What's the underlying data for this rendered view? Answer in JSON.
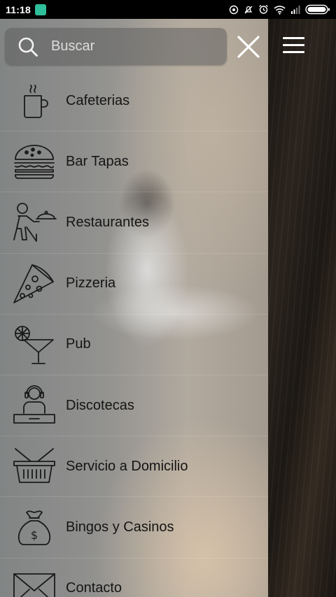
{
  "status_bar": {
    "time": "11:18",
    "app_badge_icon": "chat-app-icon",
    "icons": [
      "alarm-icon",
      "mute-icon",
      "alarm-clock-icon",
      "wifi-icon",
      "signal-icon",
      "battery-icon"
    ]
  },
  "search": {
    "placeholder": "Buscar",
    "value": ""
  },
  "menu": {
    "items": [
      {
        "label": "Cafeterias",
        "icon": "coffee-cup-icon"
      },
      {
        "label": "Bar Tapas",
        "icon": "burger-icon"
      },
      {
        "label": "Restaurantes",
        "icon": "waiter-icon"
      },
      {
        "label": "Pizzeria",
        "icon": "pizza-slice-icon"
      },
      {
        "label": "Pub",
        "icon": "cocktail-icon"
      },
      {
        "label": "Discotecas",
        "icon": "dj-icon"
      },
      {
        "label": "Servicio a Domicilio",
        "icon": "basket-icon"
      },
      {
        "label": "Bingos y Casinos",
        "icon": "money-bag-icon"
      },
      {
        "label": "Contacto",
        "icon": "envelope-icon"
      }
    ]
  },
  "colors": {
    "status_bar": "#000000",
    "menu_text": "#151515",
    "icon_stroke": "#1a1a1a"
  }
}
